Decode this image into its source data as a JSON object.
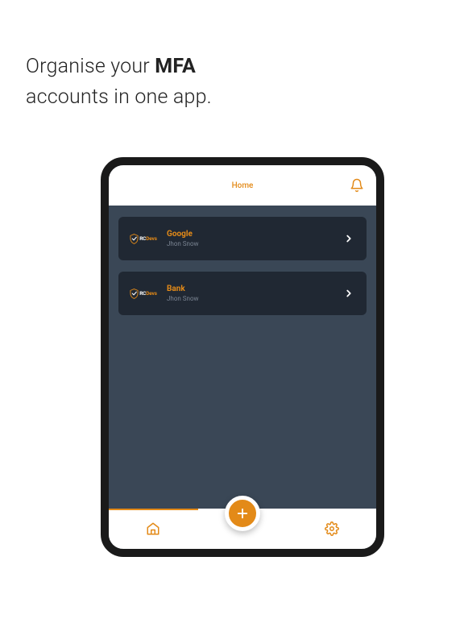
{
  "colors": {
    "accent": "#e38a18",
    "card": "#202833",
    "appbg": "#3a4756"
  },
  "headline": {
    "prefix": "Organise your ",
    "bold": "MFA",
    "suffix": "accounts in one app."
  },
  "topbar": {
    "title": "Home"
  },
  "accounts": [
    {
      "provider": "Google",
      "user": "Jhon Snow"
    },
    {
      "provider": "Bank",
      "user": "Jhon Snow"
    }
  ],
  "logo": {
    "rc": "RC",
    "devs": "Devs"
  }
}
